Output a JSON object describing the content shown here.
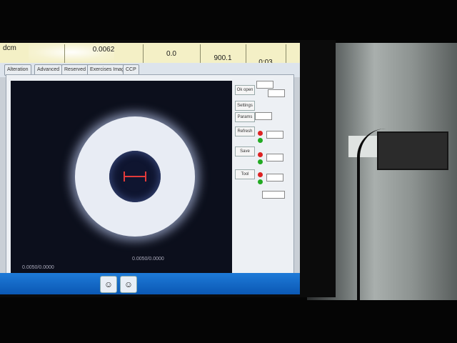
{
  "topbar": {
    "cells": [
      {
        "label": "dcm"
      },
      {
        "label": "0.0062"
      },
      {
        "label": "0.0"
      },
      {
        "label": "900.1"
      },
      {
        "label": "0:03"
      }
    ]
  },
  "toolbar": {
    "buttons": [
      "Alteration",
      "Advanced",
      "Reserved",
      "Exercises Image",
      "CCP"
    ]
  },
  "window": {
    "scale_bottom_left": "0.0050/0.0000",
    "scale_bottom_mid": "0.0050/0.0000"
  },
  "side_panel": {
    "buttons": [
      "Ok open",
      "Settings",
      "Params",
      "Refresh",
      "Save",
      "Tool"
    ],
    "leds": [
      "red",
      "green",
      "red",
      "green",
      "red",
      "green"
    ]
  },
  "colors": {
    "crosshair": "#e23a3a",
    "taskbar": "#0b58b4",
    "topbar": "#f4f0c6"
  }
}
